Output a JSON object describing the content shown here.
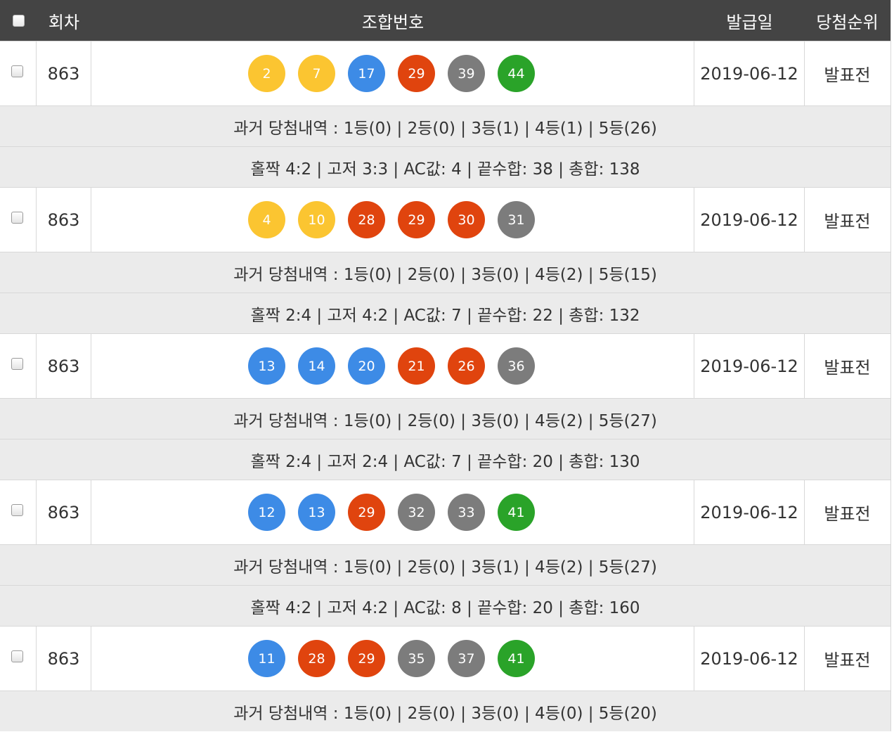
{
  "header": {
    "round": "회차",
    "combination": "조합번호",
    "issue_date": "발급일",
    "rank": "당첨순위"
  },
  "colors": {
    "yellow": "#fbc531",
    "blue": "#3d8be6",
    "red": "#e0440e",
    "gray": "#7c7c7c",
    "green": "#2aa329",
    "header_bg": "#444444",
    "sub_row_bg": "#ebebeb"
  },
  "rows": [
    {
      "round": "863",
      "balls": [
        {
          "n": "2",
          "color": "#fbc531"
        },
        {
          "n": "7",
          "color": "#fbc531"
        },
        {
          "n": "17",
          "color": "#3d8be6"
        },
        {
          "n": "29",
          "color": "#e0440e"
        },
        {
          "n": "39",
          "color": "#7c7c7c"
        },
        {
          "n": "44",
          "color": "#2aa329"
        }
      ],
      "date": "2019-06-12",
      "rank": "발표전",
      "history": "과거 당첨내역 : 1등(0) | 2등(0) | 3등(1) | 4등(1) | 5등(26)",
      "stats": "홀짝 4:2 | 고저 3:3 | AC값: 4 | 끝수합: 38 | 총합: 138"
    },
    {
      "round": "863",
      "balls": [
        {
          "n": "4",
          "color": "#fbc531"
        },
        {
          "n": "10",
          "color": "#fbc531"
        },
        {
          "n": "28",
          "color": "#e0440e"
        },
        {
          "n": "29",
          "color": "#e0440e"
        },
        {
          "n": "30",
          "color": "#e0440e"
        },
        {
          "n": "31",
          "color": "#7c7c7c"
        }
      ],
      "date": "2019-06-12",
      "rank": "발표전",
      "history": "과거 당첨내역 : 1등(0) | 2등(0) | 3등(0) | 4등(2) | 5등(15)",
      "stats": "홀짝 2:4 | 고저 4:2 | AC값: 7 | 끝수합: 22 | 총합: 132"
    },
    {
      "round": "863",
      "balls": [
        {
          "n": "13",
          "color": "#3d8be6"
        },
        {
          "n": "14",
          "color": "#3d8be6"
        },
        {
          "n": "20",
          "color": "#3d8be6"
        },
        {
          "n": "21",
          "color": "#e0440e"
        },
        {
          "n": "26",
          "color": "#e0440e"
        },
        {
          "n": "36",
          "color": "#7c7c7c"
        }
      ],
      "date": "2019-06-12",
      "rank": "발표전",
      "history": "과거 당첨내역 : 1등(0) | 2등(0) | 3등(0) | 4등(2) | 5등(27)",
      "stats": "홀짝 2:4 | 고저 2:4 | AC값: 7 | 끝수합: 20 | 총합: 130"
    },
    {
      "round": "863",
      "balls": [
        {
          "n": "12",
          "color": "#3d8be6"
        },
        {
          "n": "13",
          "color": "#3d8be6"
        },
        {
          "n": "29",
          "color": "#e0440e"
        },
        {
          "n": "32",
          "color": "#7c7c7c"
        },
        {
          "n": "33",
          "color": "#7c7c7c"
        },
        {
          "n": "41",
          "color": "#2aa329"
        }
      ],
      "date": "2019-06-12",
      "rank": "발표전",
      "history": "과거 당첨내역 : 1등(0) | 2등(0) | 3등(1) | 4등(2) | 5등(27)",
      "stats": "홀짝 4:2 | 고저 4:2 | AC값: 8 | 끝수합: 20 | 총합: 160"
    },
    {
      "round": "863",
      "balls": [
        {
          "n": "11",
          "color": "#3d8be6"
        },
        {
          "n": "28",
          "color": "#e0440e"
        },
        {
          "n": "29",
          "color": "#e0440e"
        },
        {
          "n": "35",
          "color": "#7c7c7c"
        },
        {
          "n": "37",
          "color": "#7c7c7c"
        },
        {
          "n": "41",
          "color": "#2aa329"
        }
      ],
      "date": "2019-06-12",
      "rank": "발표전",
      "history": "과거 당첨내역 : 1등(0) | 2등(0) | 3등(0) | 4등(0) | 5등(20)",
      "stats": null
    }
  ]
}
